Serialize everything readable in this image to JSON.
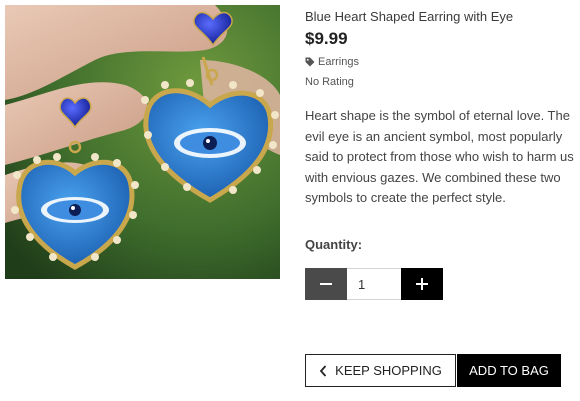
{
  "product": {
    "title": "Blue Heart Shaped Earring with Eye",
    "price": "$9.99",
    "category": "Earrings",
    "rating": "No Rating",
    "description": "Heart shape is the symbol of eternal love. The evil eye is an ancient symbol, most popularly said to protect from those who wish to harm us with envious gazes. We combined these two symbols to create the perfect style.",
    "image_icon": "earring-photo"
  },
  "quantity": {
    "label": "Quantity:",
    "value": "1",
    "minus_icon": "minus-icon",
    "plus_icon": "plus-icon"
  },
  "actions": {
    "keep_shopping_label": "KEEP SHOPPING",
    "add_to_bag_label": "ADD TO BAG"
  },
  "colors": {
    "accent": "#000000",
    "enamel_blue": "#1f6fc4",
    "gem_blue": "#1a2fbf"
  }
}
